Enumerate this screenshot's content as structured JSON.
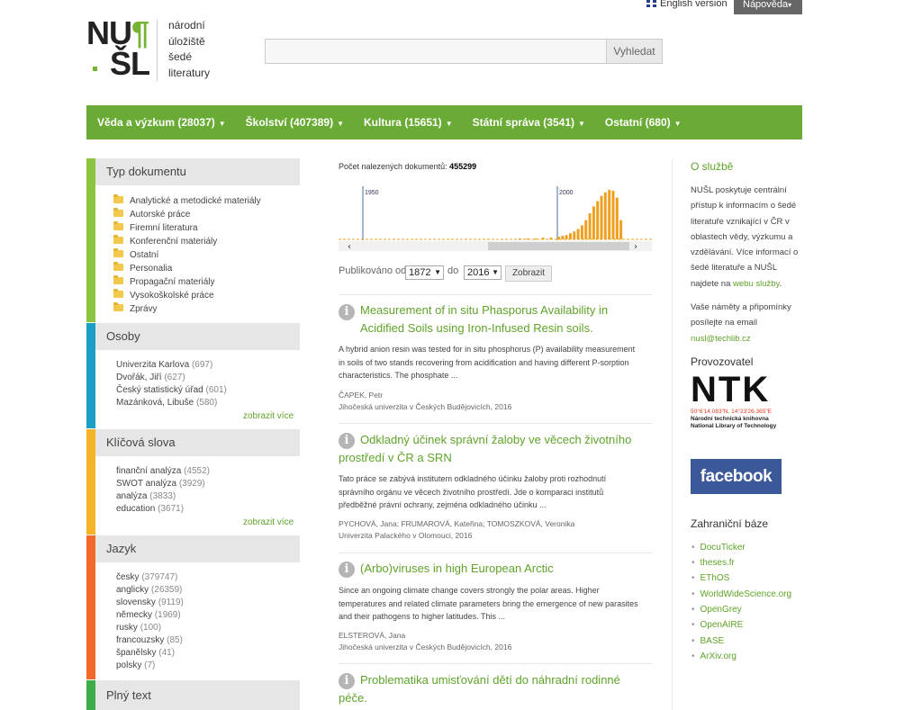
{
  "top": {
    "english": "English version",
    "help": "Nápověda"
  },
  "logo": {
    "l1": "NU",
    "l1b": "¶",
    "l2": "ŠL",
    "text": [
      "národní",
      "úložiště",
      "šedé",
      "literatury"
    ]
  },
  "search": {
    "button": "Vyhledat",
    "value": ""
  },
  "nav": [
    {
      "label": "Věda a výzkum (28037)"
    },
    {
      "label": "Školství (407389)"
    },
    {
      "label": "Kultura (15651)"
    },
    {
      "label": "Státní správa (3541)"
    },
    {
      "label": "Ostatní (680)"
    }
  ],
  "colors": {
    "nav": "#6aab36",
    "stripe_typ": "#8bc53f",
    "stripe_osoby": "#1b9fc4",
    "stripe_klic": "#f5b428",
    "stripe_jazyk": "#ef6a2b",
    "stripe_text": "#3dad4a",
    "link": "#5fa32a"
  },
  "sidebar": {
    "typ": {
      "title": "Typ dokumentu",
      "items": [
        "Analytické a metodické materiály",
        "Autorské práce",
        "Firemní literatura",
        "Konferenční materiály",
        "Ostatní",
        "Personalia",
        "Propagační materiály",
        "Vysokoškolské práce",
        "Zprávy"
      ]
    },
    "osoby": {
      "title": "Osoby",
      "items": [
        {
          "name": "Univerzita Karlova",
          "count": "(697)"
        },
        {
          "name": "Dvořák, Jiří",
          "count": "(627)"
        },
        {
          "name": "Český statistický úřad",
          "count": "(601)"
        },
        {
          "name": "Mazánková, Libuše",
          "count": "(580)"
        }
      ],
      "more": "zobrazit více"
    },
    "klic": {
      "title": "Klíčová slova",
      "items": [
        {
          "name": "finanční analýza",
          "count": "(4552)"
        },
        {
          "name": "SWOT analýza",
          "count": "(3929)"
        },
        {
          "name": "analýza",
          "count": "(3833)"
        },
        {
          "name": "education",
          "count": "(3671)"
        }
      ],
      "more": "zobrazit více"
    },
    "jazyk": {
      "title": "Jazyk",
      "items": [
        {
          "name": "česky",
          "count": "(379747)"
        },
        {
          "name": "anglicky",
          "count": "(26359)"
        },
        {
          "name": "slovensky",
          "count": "(9119)"
        },
        {
          "name": "německy",
          "count": "(1969)"
        },
        {
          "name": "rusky",
          "count": "(100)"
        },
        {
          "name": "francouzsky",
          "count": "(85)"
        },
        {
          "name": "španělsky",
          "count": "(41)"
        },
        {
          "name": "polsky",
          "count": "(7)"
        }
      ]
    },
    "text": {
      "title": "Plný text"
    }
  },
  "results": {
    "count_label": "Počet nalezených dokumentů:",
    "count": "455299",
    "timeline": {
      "start_label": "1950",
      "mid_label": "2000"
    },
    "pub_label": "Publikováno od",
    "from": "1872",
    "to_label": "do",
    "to": "2016",
    "show": "Zobrazit",
    "items": [
      {
        "title1": "Measurement of in situ Phasporus Availability in",
        "title2": "Acidified Soils using Iron-Infused Resin soils.",
        "abs1": "A hybrid anion resin was tested for in situ phosphorus (P) availability measurement",
        "abs2": "in soils of two stands recovering from acidification and having different P-sorption",
        "abs3": "characteristics. The phosphate ...",
        "author": "ČAPEK, Petr",
        "inst": "Jihočeská univerzita v Českých Budějovicích, 2016"
      },
      {
        "title1": "Odkladný účinek správní žaloby ve věcech životního",
        "title2": "prostředí v ČR a SRN",
        "abs1": "Tato práce se zabývá institutem odkladného účinku žaloby proti rozhodnutí",
        "abs2": "správního orgánu ve věcech životního prostředí. Jde o komparaci institutů",
        "abs3": "předběžné právní ochrany, zejména odkladného účinku ...",
        "author": "PYCHOVÁ, Jana; FRUMAROVÁ, Kateřina; TOMOSZKOVÁ, Veronika",
        "inst": "Univerzita Palackého v Olomouci, 2016"
      },
      {
        "title1": "(Arbo)viruses in high European Arctic",
        "title2": "",
        "abs1": "Since an ongoing climate change covers strongly the polar areas. Higher",
        "abs2": "temperatures and related climate parameters bring the emergence of new parasites",
        "abs3": "and their pathogens to higher latitudes. This ...",
        "author": "ELSTEROVÁ, Jana",
        "inst": "Jihočeská univerzita v Českých Budějovicích, 2016"
      },
      {
        "title1": "Problematika umisťování dětí do náhradní rodinné",
        "title2": "péče."
      }
    ]
  },
  "right": {
    "about_title": "O službě",
    "about_lines": [
      "NUŠL poskytuje centrální",
      "přístup k informacím o šedé",
      "literatuře vznikající v ČR v",
      "oblastech vědy, výzkumu a",
      "vzdělávání. Více informací o",
      "šedé literatuře a NUŠL"
    ],
    "about_last_pre": "najdete na ",
    "about_link": "webu služby",
    "about_last_post": ".",
    "feedback_lines": [
      "Vaše náměty a připomínky",
      "posílejte na email"
    ],
    "email": "nusl@techlib.cz",
    "provider_title": "Provozovatel",
    "ntk": "NTK",
    "ntk_coords": "50°6'14.083\"N, 14°23'26.365\"E",
    "ntk_cz": "Národní technická knihovna",
    "ntk_en": "National Library of Technology",
    "facebook": "facebook",
    "foreign_title": "Zahraniční báze",
    "foreign": [
      "DocuTicker",
      "theses.fr",
      "EThOS",
      "WorldWideScience.org",
      "OpenGrey",
      "OpenAIRE",
      "BASE",
      "ArXiv.org"
    ]
  },
  "chart_data": {
    "type": "bar",
    "title": "",
    "xlabel": "",
    "ylabel": "",
    "x": [
      1990,
      1992,
      1994,
      1996,
      1998,
      2000,
      2001,
      2002,
      2003,
      2004,
      2005,
      2006,
      2007,
      2008,
      2009,
      2010,
      2011,
      2012,
      2013,
      2014,
      2015,
      2016
    ],
    "values": [
      1,
      1,
      1,
      2,
      2,
      3,
      4,
      5,
      7,
      9,
      12,
      16,
      22,
      30,
      38,
      44,
      50,
      54,
      57,
      56,
      48,
      22
    ],
    "ylim": [
      0,
      60
    ],
    "xlim": [
      1872,
      2016
    ]
  }
}
